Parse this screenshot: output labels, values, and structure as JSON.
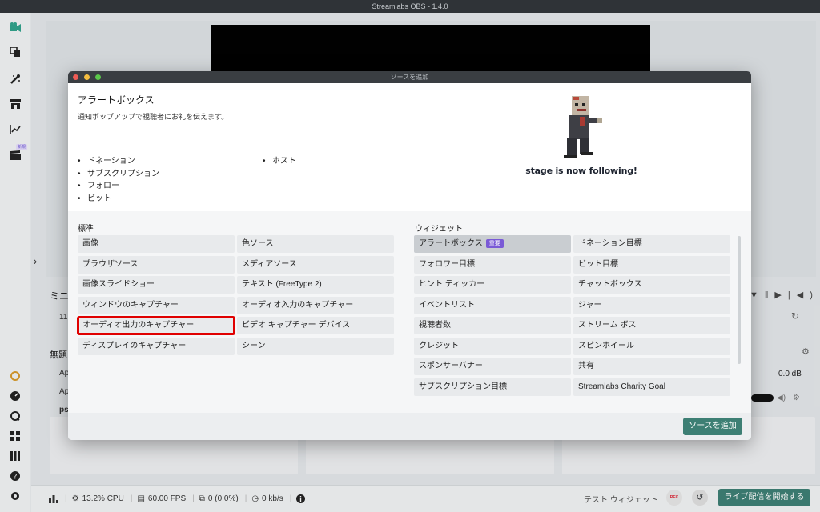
{
  "app": {
    "title": "Streamlabs OBS - 1.4.0"
  },
  "sidebar": {
    "new_badge": "新規"
  },
  "background": {
    "mixer_label": "ミニ",
    "scenes_label": "無題",
    "source_rows": [
      "Ap",
      "Ap",
      "ps"
    ],
    "mixer_value": "11",
    "db_value": "0.0 dB"
  },
  "statusbar": {
    "cpu": "13.2% CPU",
    "fps": "60.00 FPS",
    "dropped": "0 (0.0%)",
    "bandwidth": "0 kb/s",
    "test_widget": "テスト ウィジェット",
    "rec": "REC",
    "go_live": "ライブ配信を開始する"
  },
  "modal": {
    "window_title": "ソースを追加",
    "info": {
      "title": "アラートボックス",
      "description": "通知ポップアップで視聴者にお礼を伝えます。",
      "bullets_left": [
        "ドネーション",
        "サブスクリプション",
        "フォロー",
        "ビット"
      ],
      "bullets_right": [
        "ホスト"
      ],
      "preview_caption": "stage is now following!"
    },
    "standard": {
      "label": "標準",
      "items": [
        "画像",
        "色ソース",
        "ブラウザソース",
        "メディアソース",
        "画像スライドショー",
        "テキスト (FreeType 2)",
        "ウィンドウのキャプチャー",
        "オーディオ入力のキャプチャー",
        "オーディオ出力のキャプチャー",
        "ビデオ キャプチャー デバイス",
        "ディスプレイのキャプチャー",
        "シーン"
      ]
    },
    "widgets": {
      "label": "ウィジェット",
      "selected_badge": "重要",
      "items": [
        "アラートボックス",
        "ドネーション目標",
        "フォロワー目標",
        "ビット目標",
        "ヒント ティッカー",
        "チャットボックス",
        "イベントリスト",
        "ジャー",
        "視聴者数",
        "ストリーム ボス",
        "クレジット",
        "スピンホイール",
        "スポンサーバナー",
        "共有",
        "サブスクリプション目標",
        "Streamlabs Charity Goal"
      ]
    },
    "add_button": "ソースを追加"
  },
  "colors": {
    "accent": "#3d7f74",
    "highlight": "#e00000",
    "badge": "#7a5ad6"
  }
}
